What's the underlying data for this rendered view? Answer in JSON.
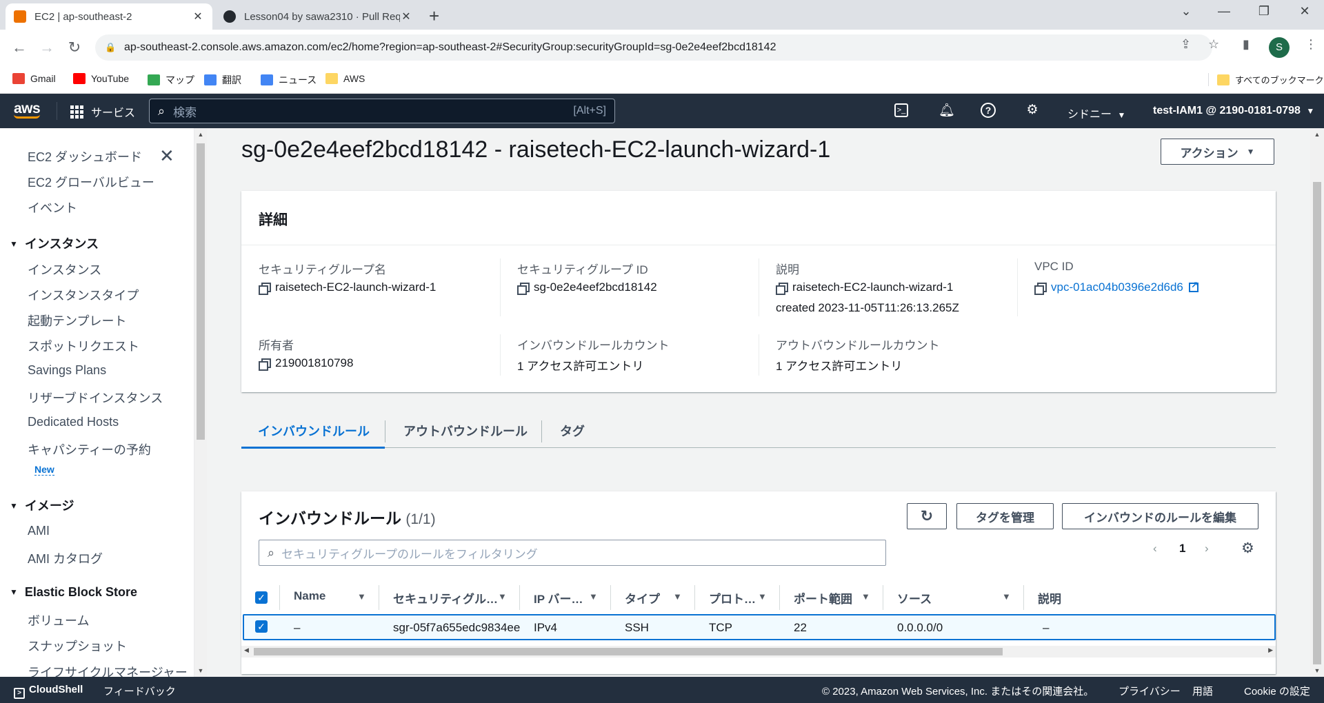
{
  "browser": {
    "tabs": [
      {
        "title": "EC2 | ap-southeast-2",
        "active": true
      },
      {
        "title": "Lesson04 by sawa2310 · Pull Req",
        "active": false
      }
    ],
    "url": "ap-southeast-2.console.aws.amazon.com/ec2/home?region=ap-southeast-2#SecurityGroup:securityGroupId=sg-0e2e4eef2bcd18142",
    "profile_initial": "S",
    "bookmarks": [
      "Gmail",
      "YouTube",
      "マップ",
      "翻訳",
      "ニュース",
      "AWS"
    ],
    "all_bookmarks": "すべてのブックマーク"
  },
  "aws_nav": {
    "logo": "aws",
    "services": "サービス",
    "search_placeholder": "検索",
    "search_shortcut": "[Alt+S]",
    "region": "シドニー",
    "account": "test-IAM1 @ 2190-0181-0798"
  },
  "sidebar": {
    "top_items": [
      "EC2 ダッシュボード",
      "EC2 グローバルビュー",
      "イベント"
    ],
    "instances_header": "インスタンス",
    "instance_items": [
      "インスタンス",
      "インスタンスタイプ",
      "起動テンプレート",
      "スポットリクエスト",
      "Savings Plans",
      "リザーブドインスタンス",
      "Dedicated Hosts",
      "キャパシティーの予約"
    ],
    "new_badge": "New",
    "images_header": "イメージ",
    "image_items": [
      "AMI",
      "AMI カタログ"
    ],
    "ebs_header": "Elastic Block Store",
    "ebs_items": [
      "ボリューム",
      "スナップショット",
      "ライフサイクルマネージャー"
    ]
  },
  "page": {
    "title": "sg-0e2e4eef2bcd18142 - raisetech-EC2-launch-wizard-1",
    "actions_button": "アクション"
  },
  "details": {
    "title": "詳細",
    "fields": [
      {
        "label": "セキュリティグループ名",
        "value": "raisetech-EC2-launch-wizard-1"
      },
      {
        "label": "セキュリティグループ ID",
        "value": "sg-0e2e4eef2bcd18142"
      },
      {
        "label": "説明",
        "value": "raisetech-EC2-launch-wizard-1",
        "value2": "created 2023-11-05T11:26:13.265Z"
      },
      {
        "label": "VPC ID",
        "value": "vpc-01ac04b0396e2d6d6"
      },
      {
        "label": "所有者",
        "value": "219001810798"
      },
      {
        "label": "インバウンドルールカウント",
        "value": "1 アクセス許可エントリ"
      },
      {
        "label": "アウトバウンドルールカウント",
        "value": "1 アクセス許可エントリ"
      }
    ]
  },
  "tabs": [
    "インバウンドルール",
    "アウトバウンドルール",
    "タグ"
  ],
  "inbound": {
    "title": "インバウンドルール",
    "count": "(1/1)",
    "manage_tags": "タグを管理",
    "edit_rules": "インバウンドのルールを編集",
    "filter_placeholder": "セキュリティグループのルールをフィルタリング",
    "page": "1",
    "columns": [
      "Name",
      "セキュリティグル…",
      "IP バー…",
      "タイプ",
      "プロト…",
      "ポート範囲",
      "ソース",
      "説明"
    ],
    "rows": [
      [
        "–",
        "sgr-05f7a655edc9834ee",
        "IPv4",
        "SSH",
        "TCP",
        "22",
        "0.0.0.0/0",
        "–"
      ]
    ]
  },
  "footer": {
    "cloudshell": "CloudShell",
    "feedback": "フィードバック",
    "copyright": "© 2023, Amazon Web Services, Inc. またはその関連会社。",
    "privacy": "プライバシー",
    "terms": "用語",
    "cookie": "Cookie の設定"
  }
}
